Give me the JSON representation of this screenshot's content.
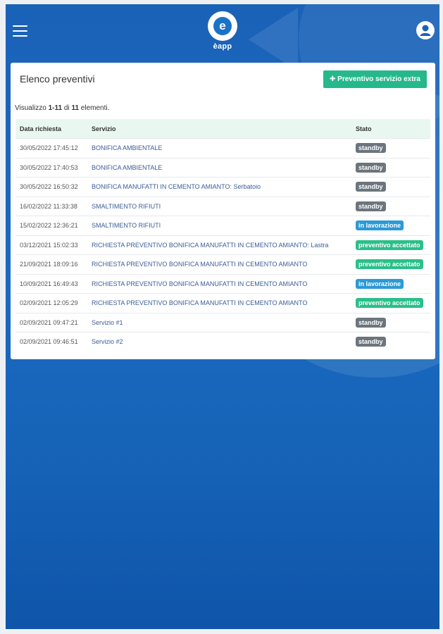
{
  "header": {
    "app_name": "èapp",
    "logo_letter": "e"
  },
  "card": {
    "title": "Elenco preventivi",
    "extra_button": "✚ Preventivo servizio extra",
    "summary_prefix": "Visualizzo ",
    "summary_range": "1-11",
    "summary_mid": " di ",
    "summary_total": "11",
    "summary_suffix": " elementi."
  },
  "table": {
    "columns": [
      "Data richiesta",
      "Servizio",
      "Stato"
    ],
    "rows": [
      {
        "date": "30/05/2022 17:45:12",
        "service": "BONIFICA AMBIENTALE",
        "status": "standby"
      },
      {
        "date": "30/05/2022 17:40:53",
        "service": "BONIFICA AMBIENTALE",
        "status": "standby"
      },
      {
        "date": "30/05/2022 16:50:32",
        "service": "BONIFICA MANUFATTI IN CEMENTO AMIANTO: Serbatoio",
        "status": "standby"
      },
      {
        "date": "16/02/2022 11:33:38",
        "service": "SMALTIMENTO RIFIUTI",
        "status": "standby"
      },
      {
        "date": "15/02/2022 12:36:21",
        "service": "SMALTIMENTO RIFIUTI",
        "status": "in lavorazione"
      },
      {
        "date": "03/12/2021 15:02:33",
        "service": "RICHIESTA PREVENTIVO BONIFICA MANUFATTI IN CEMENTO AMIANTO: Lastra",
        "status": "preventivo accettato"
      },
      {
        "date": "21/09/2021 18:09:16",
        "service": "RICHIESTA PREVENTIVO BONIFICA MANUFATTI IN CEMENTO AMIANTO",
        "status": "preventivo accettato"
      },
      {
        "date": "10/09/2021 16:49:43",
        "service": "RICHIESTA PREVENTIVO BONIFICA MANUFATTI IN CEMENTO AMIANTO",
        "status": "in lavorazione"
      },
      {
        "date": "02/09/2021 12:05:29",
        "service": "RICHIESTA PREVENTIVO BONIFICA MANUFATTI IN CEMENTO AMIANTO",
        "status": "preventivo accettato"
      },
      {
        "date": "02/09/2021 09:47:21",
        "service": "Servizio #1",
        "status": "standby"
      },
      {
        "date": "02/09/2021 09:46:51",
        "service": "Servizio #2",
        "status": "standby"
      }
    ]
  },
  "colors": {
    "background_blue": "#1a62b8",
    "header_row": "#e8f7ef",
    "button_green": "#26b88c",
    "standby": "#6c757d",
    "in_lavorazione": "#2b9ad6",
    "preventivo_accettato": "#2bbf8a"
  },
  "icons": {
    "menu": "hamburger-menu-icon",
    "user": "user-icon",
    "plus": "plus-icon"
  }
}
